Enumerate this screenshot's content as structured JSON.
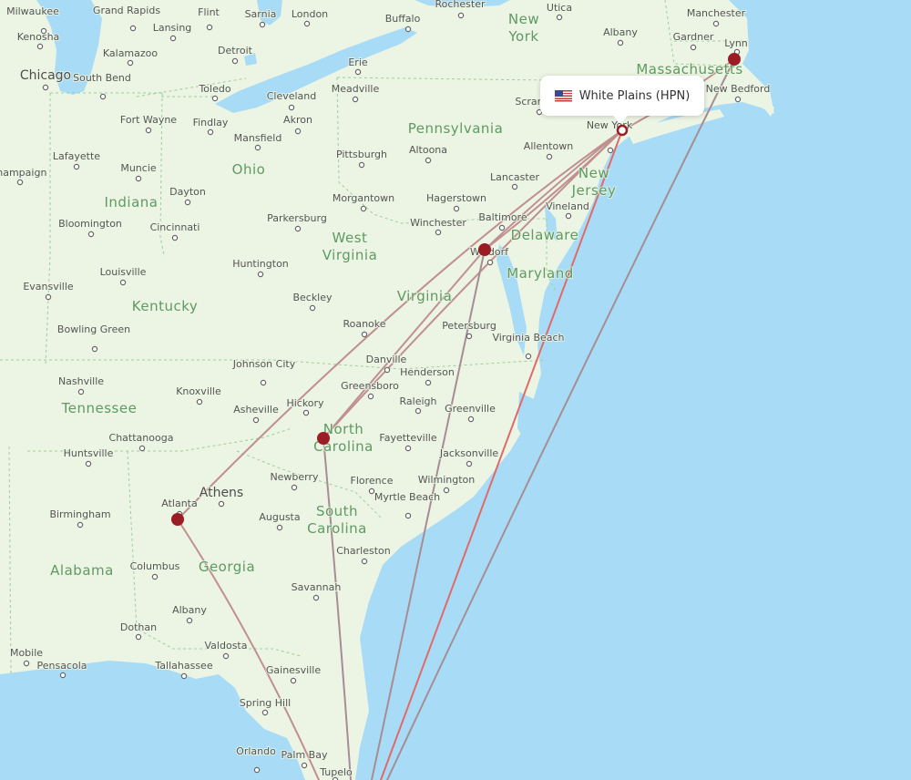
{
  "map": {
    "colors": {
      "water": "#a8dcf6",
      "land": "#ecf4e4",
      "route_primary": "#e06a6a",
      "route_secondary": "#b87c7c",
      "route_grey": "#9a8b92",
      "airport": "#9b1c22",
      "state_label": "#5e9a62"
    },
    "tooltip": {
      "flag_icon": "us-flag",
      "label": "White Plains (HPN)"
    },
    "origin": {
      "name": "White Plains",
      "code": "HPN"
    },
    "destination_markers": [
      {
        "name": "Boston area (near Lynn)"
      },
      {
        "name": "Washington area (near Waldorf)"
      },
      {
        "name": "Charlotte area (North Carolina)"
      },
      {
        "name": "Atlanta"
      }
    ],
    "states": [
      "New York",
      "Pennsylvania",
      "Ohio",
      "Indiana",
      "West Virginia",
      "Virginia",
      "Kentucky",
      "Tennessee",
      "North Carolina",
      "South Carolina",
      "Georgia",
      "Alabama",
      "Maryland",
      "Delaware",
      "New Jersey",
      "Massachusetts"
    ],
    "cities": [
      "Milwaukee",
      "Grand Rapids",
      "Flint",
      "Sarnia",
      "London",
      "Rochester",
      "Utica",
      "Kenosha",
      "Lansing",
      "Detroit",
      "Buffalo",
      "Albany",
      "Manchester",
      "Gardner",
      "Lynn",
      "Chicago",
      "Kalamazoo",
      "South Bend",
      "Toledo",
      "Cleveland",
      "Erie",
      "Meadville",
      "Akron",
      "Fort Wayne",
      "Findlay",
      "Mansfield",
      "Pittsburgh",
      "Altoona",
      "Allentown",
      "Scranton",
      "New York",
      "New Bedford",
      "Lafayette",
      "Champaign",
      "Muncie",
      "Dayton",
      "Lancaster",
      "Morgantown",
      "Hagerstown",
      "Baltimore",
      "Vineland",
      "Bloomington",
      "Cincinnati",
      "Parkersburg",
      "Winchester",
      "Waldorf",
      "Huntington",
      "Louisville",
      "Evansville",
      "Beckley",
      "Roanoke",
      "Petersburg",
      "Virginia Beach",
      "Bowling Green",
      "Johnson City",
      "Danville",
      "Henderson",
      "Nashville",
      "Knoxville",
      "Greensboro",
      "Raleigh",
      "Greenville",
      "Hickory",
      "Asheville",
      "Chattanooga",
      "Fayetteville",
      "Jacksonville",
      "Huntsville",
      "Newberry",
      "Florence",
      "Wilmington",
      "Myrtle Beach",
      "Atlanta",
      "Athens",
      "Birmingham",
      "Augusta",
      "Charleston",
      "Columbus",
      "Savannah",
      "Albany",
      "Dothan",
      "Valdosta",
      "Mobile",
      "Pensacola",
      "Tallahassee",
      "Gainesville",
      "Spring Hill",
      "Orlando",
      "Palm Bay",
      "Tupelo"
    ]
  }
}
